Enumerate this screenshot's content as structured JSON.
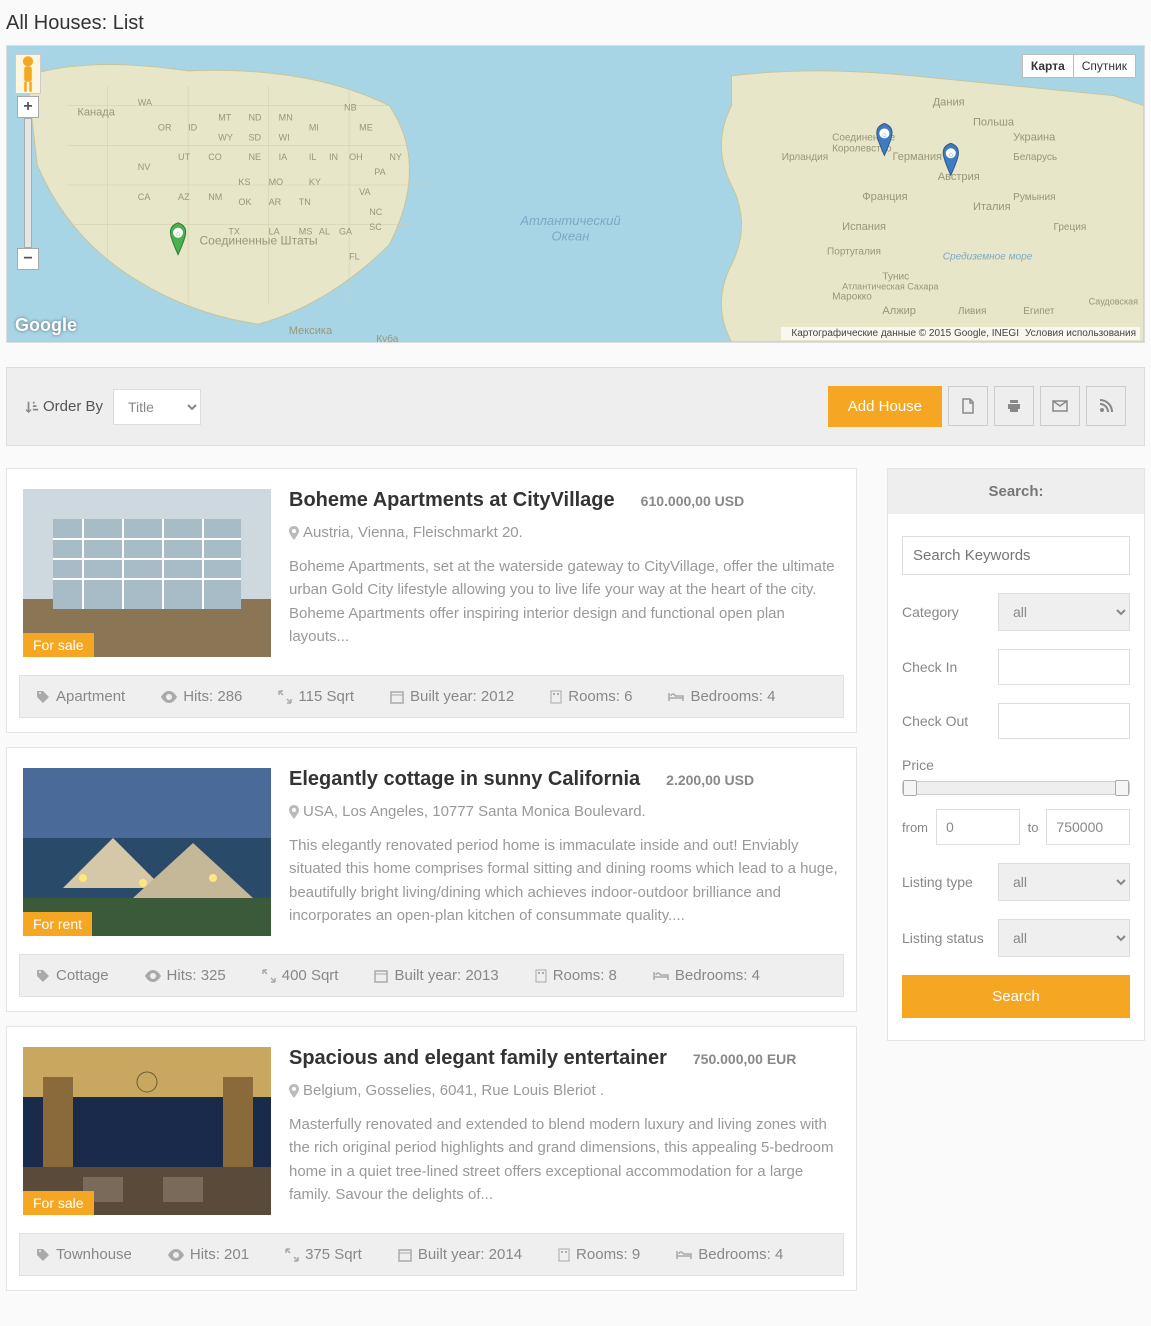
{
  "page_title": "All Houses: List",
  "map": {
    "type_buttons": [
      "Карта",
      "Спутник"
    ],
    "attribution": "Картографические данные © 2015 Google, INEGI",
    "terms": "Условия использования",
    "logo": "Google"
  },
  "toolbar": {
    "order_by_label": "Order By",
    "order_by_value": "Title",
    "add_label": "Add House"
  },
  "listings": [
    {
      "title": "Boheme Apartments at CityVillage",
      "price": "610.000,00 USD",
      "location": "Austria, Vienna, Fleischmarkt 20.",
      "desc": "Boheme Apartments, set at the waterside gateway to CityVillage, offer the ultimate urban Gold City lifestyle allowing you to live life your way at the heart of the city. Boheme Apartments offer inspiring interior design and functional open plan layouts...",
      "badge": "For sale",
      "meta": {
        "category": "Apartment",
        "hits": "Hits: 286",
        "area": "115 Sqrt",
        "built": "Built year: 2012",
        "rooms": "Rooms: 6",
        "bedrooms": "Bedrooms: 4"
      }
    },
    {
      "title": "Elegantly cottage in sunny California",
      "price": "2.200,00 USD",
      "location": "USA, Los Angeles, 10777 Santa Monica Boulevard.",
      "desc": "This elegantly renovated period home is immaculate inside and out! Enviably situated this home comprises formal sitting and dining rooms which lead to a huge, beautifully bright living/dining which achieves indoor-outdoor brilliance and incorporates an open-plan kitchen of consummate quality....",
      "badge": "For rent",
      "meta": {
        "category": "Cottage",
        "hits": "Hits: 325",
        "area": "400 Sqrt",
        "built": "Built year: 2013",
        "rooms": "Rooms: 8",
        "bedrooms": "Bedrooms: 4"
      }
    },
    {
      "title": "Spacious and elegant family entertainer",
      "price": "750.000,00 EUR",
      "location": "Belgium, Gosselies, 6041, Rue Louis Bleriot .",
      "desc": "Masterfully renovated and extended to blend modern luxury and living zones with the rich original period highlights and grand dimensions, this appealing 5-bedroom home in a quiet tree-lined street offers exceptional accommodation for a large family. Savour the delights of...",
      "badge": "For sale",
      "meta": {
        "category": "Townhouse",
        "hits": "Hits: 201",
        "area": "375 Sqrt",
        "built": "Built year: 2014",
        "rooms": "Rooms: 9",
        "bedrooms": "Bedrooms: 4"
      }
    }
  ],
  "search": {
    "heading": "Search:",
    "keywords_placeholder": "Search Keywords",
    "category_label": "Category",
    "category_value": "all",
    "checkin_label": "Check In",
    "checkout_label": "Check Out",
    "price_label": "Price",
    "from_label": "from",
    "to_label": "to",
    "price_from": "0",
    "price_to": "750000",
    "listing_type_label": "Listing type",
    "listing_type_value": "all",
    "listing_status_label": "Listing status",
    "listing_status_value": "all",
    "button": "Search"
  }
}
